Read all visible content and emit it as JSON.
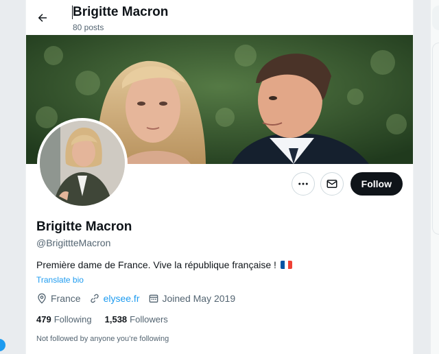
{
  "header": {
    "title": "Brigitte Macron",
    "posts_count": "80 posts"
  },
  "icons": {
    "back": "arrow-left-icon",
    "more": "more-horizontal-icon",
    "message": "envelope-icon",
    "location": "location-pin-icon",
    "link": "link-icon",
    "calendar": "calendar-icon"
  },
  "profile": {
    "display_name": "Brigitte Macron",
    "handle": "@BrigittteMacron",
    "bio": "Première dame de France. Vive la république française !",
    "translate_label": "Translate bio",
    "location": "France",
    "website": "elysee.fr",
    "joined": "Joined May 2019",
    "following_count": "479",
    "following_label": "Following",
    "followers_count": "1,538",
    "followers_label": "Followers",
    "mutuals_note": "Not followed by anyone you’re following"
  },
  "actions": {
    "follow_label": "Follow"
  },
  "colors": {
    "accent": "#1d9bf0",
    "text": "#0f1419",
    "secondary": "#536471",
    "follow_bg": "#0f1419",
    "flag_blue": "#0055a4",
    "flag_white": "#ffffff",
    "flag_red": "#ef4135"
  }
}
